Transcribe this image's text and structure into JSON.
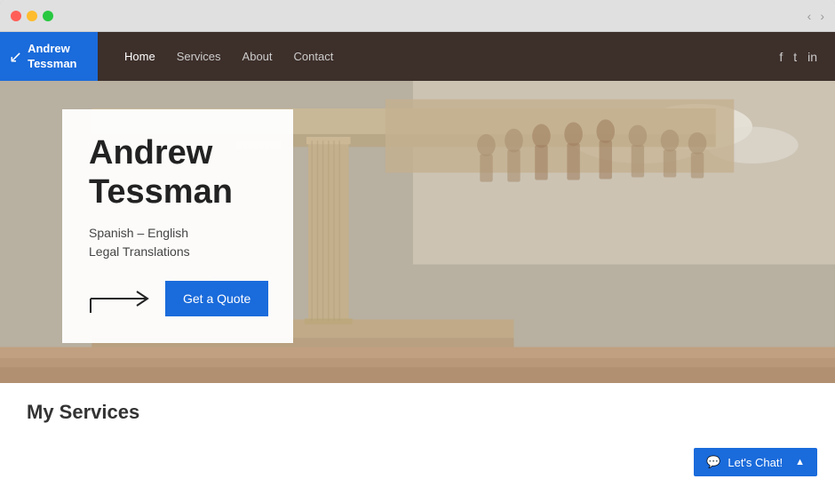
{
  "browser": {
    "dots": [
      "red",
      "yellow",
      "green"
    ],
    "nav_back": "‹",
    "nav_forward": "›"
  },
  "header": {
    "logo_icon": "↙",
    "logo_name_line1": "Andrew",
    "logo_name_line2": "Tessman",
    "nav_items": [
      {
        "label": "Home",
        "active": true
      },
      {
        "label": "Services",
        "active": false
      },
      {
        "label": "About",
        "active": false
      },
      {
        "label": "Contact",
        "active": false
      }
    ],
    "social": [
      "f",
      "t",
      "in"
    ]
  },
  "hero": {
    "title_line1": "Andrew",
    "title_line2": "Tessman",
    "subtitle_line1": "Spanish – English",
    "subtitle_line2": "Legal Translations",
    "cta_label": "Get a Quote"
  },
  "below_hero": {
    "section_title": "My Services"
  },
  "chat": {
    "icon": "💬",
    "label": "Let's Chat!",
    "expand": "▲"
  }
}
